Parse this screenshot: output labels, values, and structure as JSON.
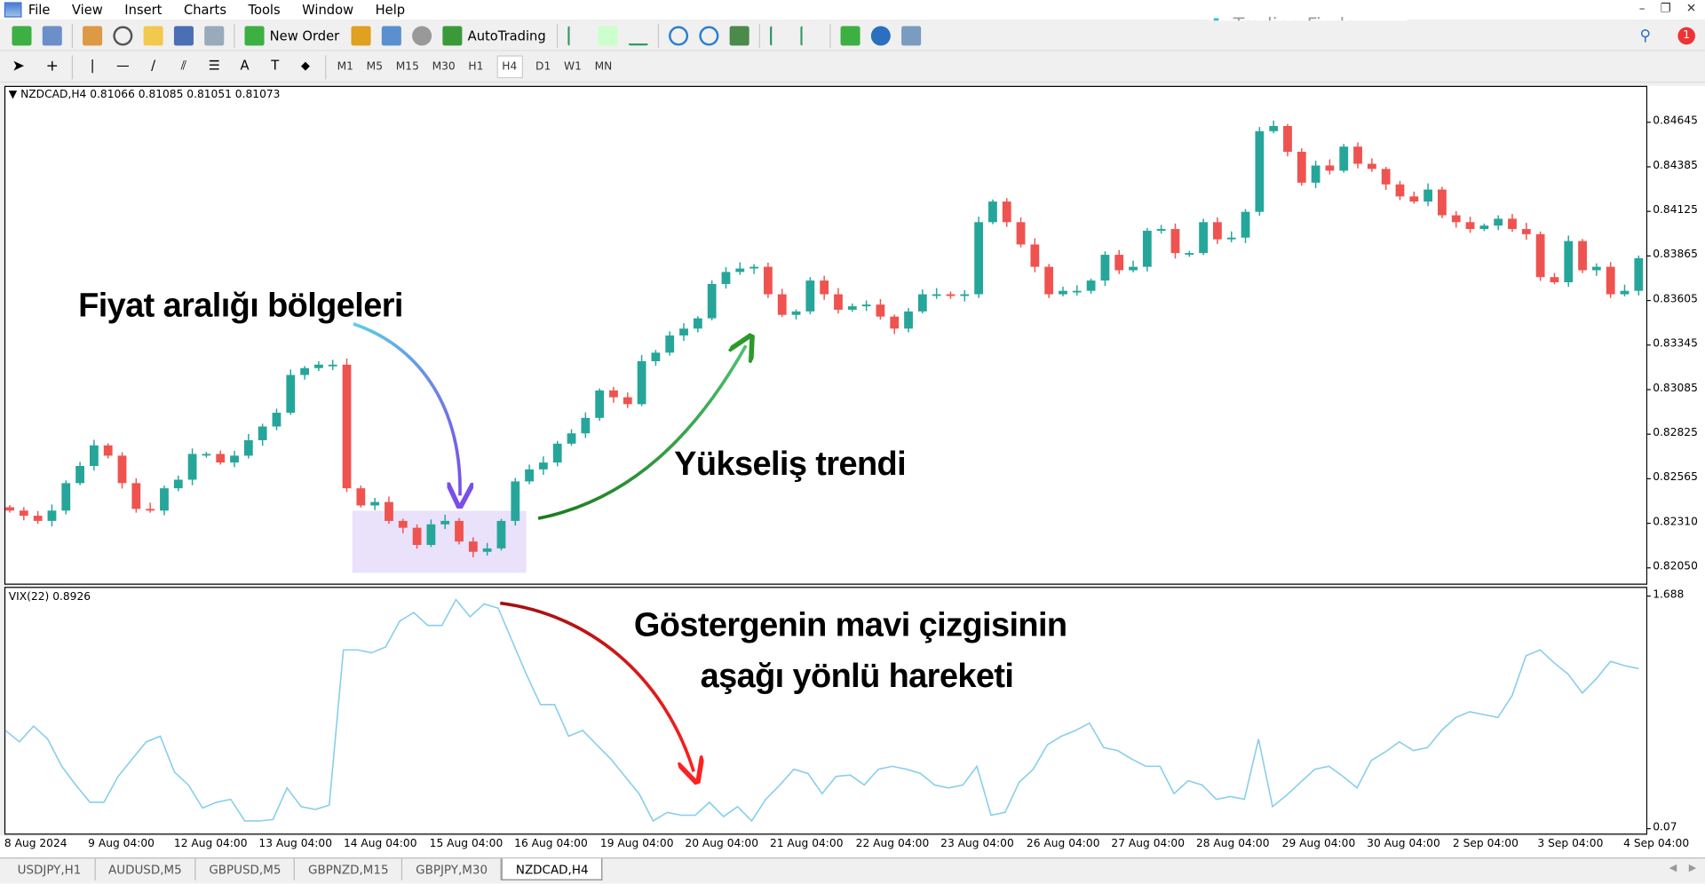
{
  "menu": {
    "items": [
      "File",
      "View",
      "Insert",
      "Charts",
      "Tools",
      "Window",
      "Help"
    ]
  },
  "toolbar": {
    "new_order": "New Order",
    "autotrading": "AutoTrading",
    "timeframes": [
      "M1",
      "M5",
      "M15",
      "M30",
      "H1",
      "H4",
      "D1",
      "W1",
      "MN"
    ],
    "active_timeframe": "H4"
  },
  "logo": {
    "text": "Trading Finder",
    "color": "#28c7d8"
  },
  "notifications": {
    "count": "1"
  },
  "chart": {
    "header": "NZDCAD,H4  0.81066 0.81085 0.81051 0.81073",
    "indicator_header": "VIX(22) 0.8926"
  },
  "price_axis": [
    "0.84645",
    "0.84385",
    "0.84125",
    "0.83865",
    "0.83605",
    "0.83345",
    "0.83085",
    "0.82825",
    "0.82565",
    "0.82310",
    "0.82050"
  ],
  "indicator_axis": [
    "1.688",
    "0.07"
  ],
  "date_axis": [
    "8 Aug 2024",
    "9 Aug 04:00",
    "12 Aug 04:00",
    "13 Aug 04:00",
    "14 Aug 04:00",
    "15 Aug 04:00",
    "16 Aug 04:00",
    "19 Aug 04:00",
    "20 Aug 04:00",
    "21 Aug 04:00",
    "22 Aug 04:00",
    "23 Aug 04:00",
    "26 Aug 04:00",
    "27 Aug 04:00",
    "28 Aug 04:00",
    "29 Aug 04:00",
    "30 Aug 04:00",
    "2 Sep 04:00",
    "3 Sep 04:00",
    "4 Sep 04:00"
  ],
  "tabs": [
    "USDJPY,H1",
    "AUDUSD,M5",
    "GBPUSD,M5",
    "GBPNZD,M15",
    "GBPJPY,M30",
    "NZDCAD,H4"
  ],
  "active_tab": "NZDCAD,H4",
  "annotations": {
    "range_zone": "Fiyat aralığı bölgeleri",
    "uptrend": "Yükseliş trendi",
    "indicator_line1": "Göstergenin mavi çizgisinin",
    "indicator_line2": "aşağı yönlü hareketi"
  },
  "colors": {
    "bull": "#26a69a",
    "bear": "#ef5350",
    "vix_line": "#87ceeb",
    "zone": "#e6dcfa",
    "arrow_range": "#5bc8e6",
    "arrow_up": "#2a9a2a",
    "arrow_down": "#d01010"
  },
  "chart_data": [
    {
      "type": "candlestick",
      "symbol": "NZDCAD",
      "timeframe": "H4",
      "ylim": [
        0.8205,
        0.84645
      ],
      "first_open": 0.824,
      "closes": [
        0.8238,
        0.8235,
        0.8232,
        0.8238,
        0.8254,
        0.8264,
        0.8276,
        0.827,
        0.8254,
        0.8239,
        0.8238,
        0.8251,
        0.8256,
        0.8271,
        0.8271,
        0.8266,
        0.827,
        0.8279,
        0.8287,
        0.8295,
        0.8317,
        0.8321,
        0.8323,
        0.8323,
        0.8251,
        0.8241,
        0.8243,
        0.8232,
        0.8228,
        0.8218,
        0.823,
        0.8232,
        0.822,
        0.8214,
        0.8216,
        0.8232,
        0.8255,
        0.8262,
        0.8266,
        0.8277,
        0.8283,
        0.8292,
        0.8308,
        0.8304,
        0.83,
        0.8325,
        0.833,
        0.834,
        0.8344,
        0.835,
        0.837,
        0.8377,
        0.8379,
        0.838,
        0.8364,
        0.8352,
        0.8354,
        0.8372,
        0.8364,
        0.8355,
        0.8357,
        0.8358,
        0.8351,
        0.8344,
        0.8354,
        0.8364,
        0.8364,
        0.8363,
        0.8364,
        0.8406,
        0.8418,
        0.8406,
        0.8393,
        0.838,
        0.8364,
        0.8366,
        0.8366,
        0.8372,
        0.8387,
        0.8378,
        0.838,
        0.8401,
        0.8402,
        0.8388,
        0.8388,
        0.8406,
        0.8396,
        0.8397,
        0.8412,
        0.8459,
        0.8462,
        0.8447,
        0.8429,
        0.8439,
        0.8436,
        0.845,
        0.844,
        0.8437,
        0.8428,
        0.8421,
        0.8418,
        0.8425,
        0.841,
        0.8406,
        0.8402,
        0.8404,
        0.8408,
        0.8402,
        0.8399,
        0.8374,
        0.8371,
        0.8395,
        0.8378,
        0.838,
        0.8364,
        0.8366,
        0.8385
      ]
    },
    {
      "type": "line",
      "name": "VIX(22)",
      "ylim": [
        0.07,
        1.688
      ],
      "values": [
        0.75,
        0.67,
        0.78,
        0.69,
        0.5,
        0.37,
        0.25,
        0.25,
        0.43,
        0.55,
        0.67,
        0.71,
        0.46,
        0.37,
        0.21,
        0.25,
        0.27,
        0.12,
        0.12,
        0.13,
        0.35,
        0.22,
        0.2,
        0.23,
        1.31,
        1.31,
        1.29,
        1.33,
        1.51,
        1.57,
        1.48,
        1.48,
        1.66,
        1.54,
        1.63,
        1.6,
        1.37,
        1.14,
        0.93,
        0.93,
        0.71,
        0.75,
        0.65,
        0.55,
        0.43,
        0.31,
        0.12,
        0.18,
        0.16,
        0.16,
        0.25,
        0.15,
        0.22,
        0.12,
        0.27,
        0.37,
        0.48,
        0.45,
        0.31,
        0.43,
        0.44,
        0.37,
        0.48,
        0.5,
        0.48,
        0.45,
        0.37,
        0.35,
        0.37,
        0.5,
        0.16,
        0.18,
        0.39,
        0.48,
        0.65,
        0.71,
        0.75,
        0.8,
        0.63,
        0.61,
        0.55,
        0.5,
        0.5,
        0.31,
        0.4,
        0.37,
        0.27,
        0.29,
        0.27,
        0.69,
        0.22,
        0.3,
        0.39,
        0.48,
        0.5,
        0.43,
        0.35,
        0.54,
        0.6,
        0.67,
        0.61,
        0.63,
        0.75,
        0.84,
        0.88,
        0.86,
        0.84,
        0.99,
        1.27,
        1.31,
        1.22,
        1.14,
        1.01,
        1.11,
        1.23,
        1.2,
        1.18
      ]
    }
  ]
}
